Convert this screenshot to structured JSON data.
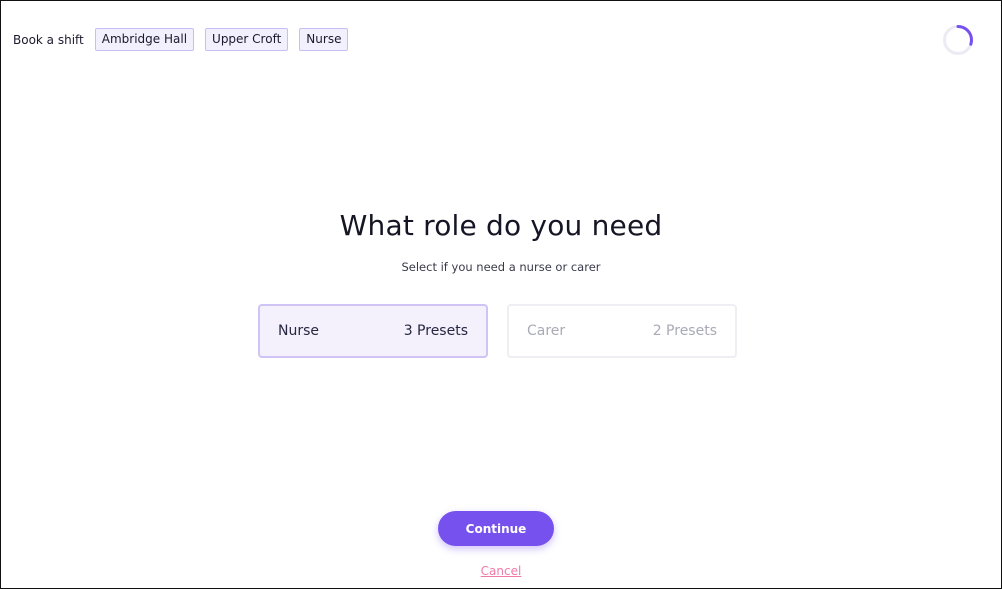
{
  "header": {
    "breadcrumb_lead": "Book a shift",
    "chips": [
      {
        "label": "Ambridge Hall"
      },
      {
        "label": "Upper Croft"
      },
      {
        "label": "Nurse"
      }
    ],
    "progress": 0.3
  },
  "main": {
    "title": "What role do you need",
    "subtitle": "Select if you need a nurse or carer",
    "options": [
      {
        "label": "Nurse",
        "presets": "3 Presets",
        "selected": true
      },
      {
        "label": "Carer",
        "presets": "2 Presets",
        "selected": false
      }
    ]
  },
  "footer": {
    "continue_label": "Continue",
    "cancel_label": "Cancel"
  },
  "colors": {
    "accent": "#7651ee",
    "chip_border": "#c9bdf3",
    "cancel": "#f07aa6"
  }
}
